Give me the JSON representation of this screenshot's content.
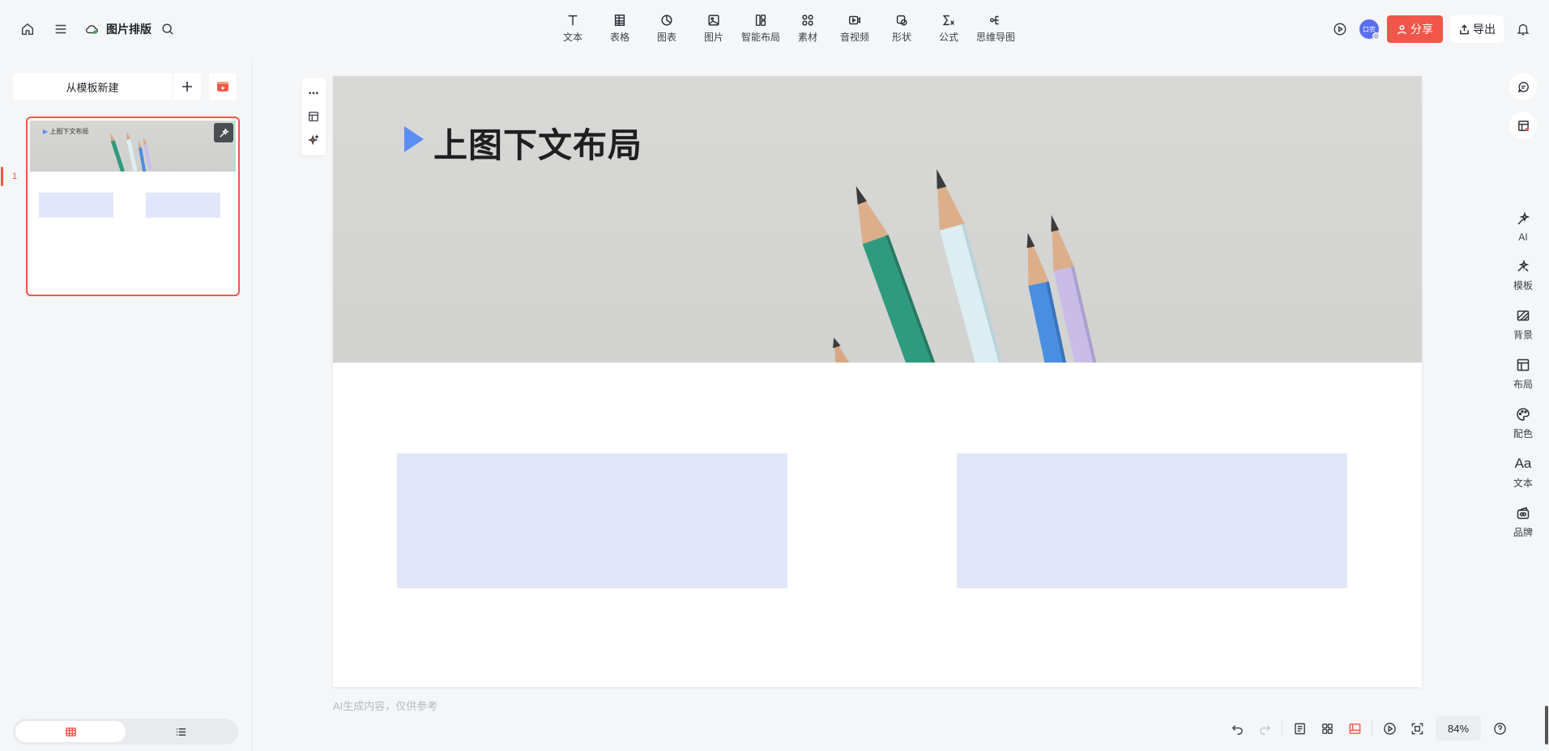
{
  "header": {
    "doc_title": "图片排版",
    "tools": [
      {
        "label": "文本",
        "icon": "text-icon"
      },
      {
        "label": "表格",
        "icon": "table-icon"
      },
      {
        "label": "图表",
        "icon": "pie-chart-icon"
      },
      {
        "label": "图片",
        "icon": "image-icon"
      },
      {
        "label": "智能布局",
        "icon": "smart-layout-icon"
      },
      {
        "label": "素材",
        "icon": "assets-grid-icon"
      },
      {
        "label": "音视频",
        "icon": "video-icon"
      },
      {
        "label": "形状",
        "icon": "shape-icon"
      },
      {
        "label": "公式",
        "icon": "formula-icon"
      },
      {
        "label": "思维导图",
        "icon": "mindmap-icon"
      }
    ],
    "avatar_text": "口农",
    "share_label": "分享",
    "export_label": "导出"
  },
  "sidebar": {
    "new_from_template": "从模板新建",
    "slide_number": "1",
    "thumb_title": "上图下文布局"
  },
  "slide": {
    "title": "上图下文布局",
    "accent_color": "#5b8ef5",
    "placeholder_color": "#e1e6fa"
  },
  "ai_note": "AI生成内容，仅供参考",
  "rightbar": {
    "items": [
      {
        "label": "AI",
        "icon": "ai-wand-icon"
      },
      {
        "label": "模板",
        "icon": "template-icon"
      },
      {
        "label": "背景",
        "icon": "background-icon"
      },
      {
        "label": "布局",
        "icon": "layout-icon"
      },
      {
        "label": "配色",
        "icon": "palette-icon"
      },
      {
        "label": "文本",
        "icon": "text-aa-icon",
        "glyph": "Aa"
      },
      {
        "label": "品牌",
        "icon": "brand-icon"
      }
    ]
  },
  "bottombar": {
    "zoom": "84%"
  },
  "colors": {
    "brand_red": "#f2564a",
    "background": "#f5f6f8"
  }
}
